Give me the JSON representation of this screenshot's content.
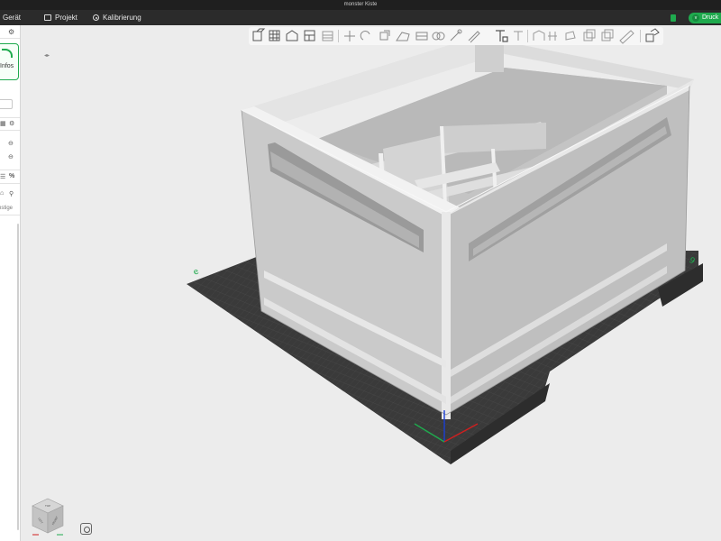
{
  "window": {
    "title": "monster Kiste"
  },
  "menubar": {
    "device_label": "Gerät",
    "project_label": "Projekt",
    "calibration_label": "Kalibrierung",
    "print_label": "Druck"
  },
  "left_panel": {
    "info_label": "Infos",
    "misc_label": "nstige"
  },
  "toolbar": {
    "tools": [
      "add-object",
      "add-plate",
      "auto-orient",
      "arrange",
      "split-plate",
      "move",
      "rotate",
      "scale",
      "lay-on-face",
      "cut",
      "mesh-boolean",
      "support-paint",
      "seam-paint",
      "text-tool",
      "assembly",
      "measure",
      "split-objects",
      "split-parts",
      "variable-layer",
      "undo-height",
      "assembly-view"
    ]
  },
  "navcube": {
    "faces": [
      "TOP",
      "LEFT",
      "FRONT"
    ]
  },
  "colors": {
    "accent": "#1faa4e",
    "menubar_bg": "#2b2b2b",
    "titlebar_bg": "#1f1f1f",
    "plate": "#3a3a3a",
    "model": "#d2d2d2"
  }
}
